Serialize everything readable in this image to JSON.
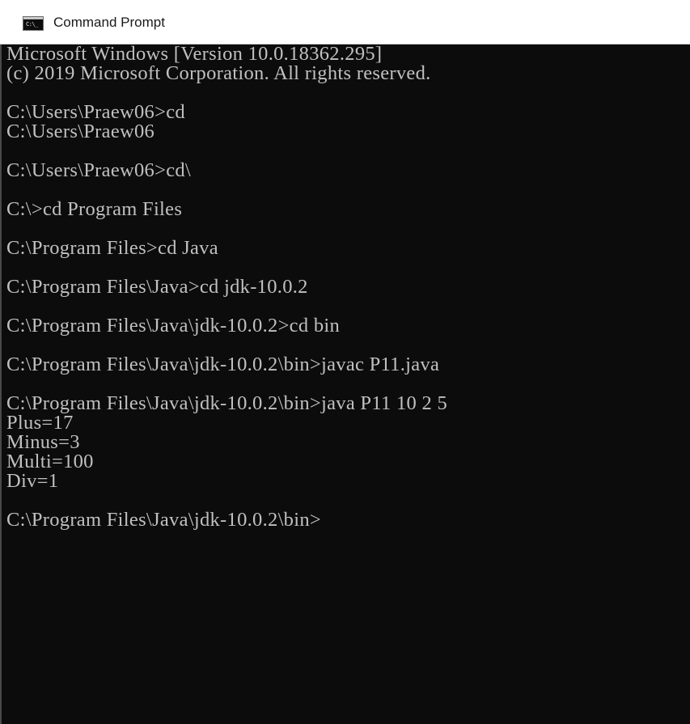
{
  "window": {
    "title": "Command Prompt",
    "icon": "cmd-app-icon",
    "icon_glyph": "C:\\_"
  },
  "colors": {
    "titlebar_bg": "#ffffff",
    "console_bg": "#0c0c0c",
    "console_text": "#c0c0c0"
  },
  "console": {
    "lines": [
      "Microsoft Windows [Version 10.0.18362.295]",
      "(c) 2019 Microsoft Corporation. All rights reserved.",
      "",
      "C:\\Users\\Praew06>cd",
      "C:\\Users\\Praew06",
      "",
      "C:\\Users\\Praew06>cd\\",
      "",
      "C:\\>cd Program Files",
      "",
      "C:\\Program Files>cd Java",
      "",
      "C:\\Program Files\\Java>cd jdk-10.0.2",
      "",
      "C:\\Program Files\\Java\\jdk-10.0.2>cd bin",
      "",
      "C:\\Program Files\\Java\\jdk-10.0.2\\bin>javac P11.java",
      "",
      "C:\\Program Files\\Java\\jdk-10.0.2\\bin>java P11 10 2 5",
      "Plus=17",
      "Minus=3",
      "Multi=100",
      "Div=1",
      "",
      "C:\\Program Files\\Java\\jdk-10.0.2\\bin>"
    ]
  }
}
